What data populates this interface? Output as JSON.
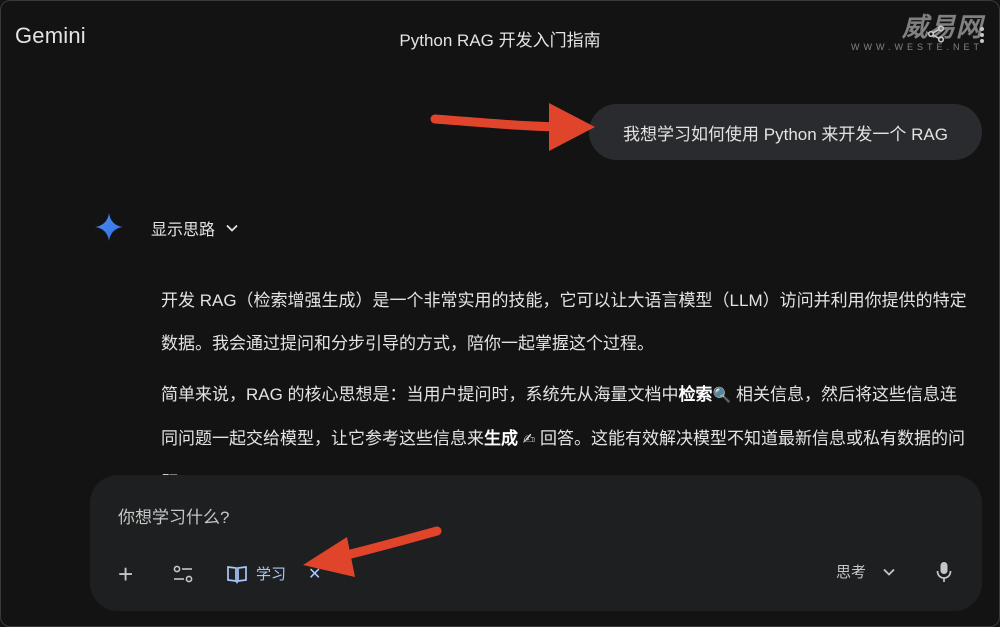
{
  "app": {
    "brand": "Gemini",
    "conversation_title": "Python RAG 开发入门指南"
  },
  "watermark": {
    "text": "威易网",
    "url": "WWW.WESTE.NET"
  },
  "user_message": "我想学习如何使用 Python 来开发一个 RAG",
  "assistant": {
    "show_thoughts_label": "显示思路",
    "p1": "开发 RAG（检索增强生成）是一个非常实用的技能，它可以让大语言模型（LLM）访问并利用你提供的特定数据。我会通过提问和分步引导的方式，陪你一起掌握这个过程。",
    "p2_a": "简单来说，RAG 的核心思想是：当用户提问时，系统先从海量文档中",
    "p2_b": "检索",
    "p2_c": "相关信息，然后将这些信息连同问题一起交给模型，让它参考这些信息来",
    "p2_d": "生成",
    "p2_e": "回答。这能有效解决模型不知道最新信息或私有数据的问题。",
    "emoji_search": "🔍",
    "emoji_write": "✍"
  },
  "composer": {
    "placeholder": "你想学习什么?",
    "learn_chip_label": "学习",
    "think_label": "思考"
  },
  "colors": {
    "accent_blue": "#a8c7fa",
    "arrow_red": "#e0452b",
    "background": "#131314",
    "surface": "#1e1f20"
  },
  "icons": [
    "share-icon",
    "kebab-menu-icon",
    "gemini-spark-icon",
    "chevron-down-icon",
    "plus-icon",
    "tools-icon",
    "book-icon",
    "close-icon",
    "microphone-icon"
  ]
}
